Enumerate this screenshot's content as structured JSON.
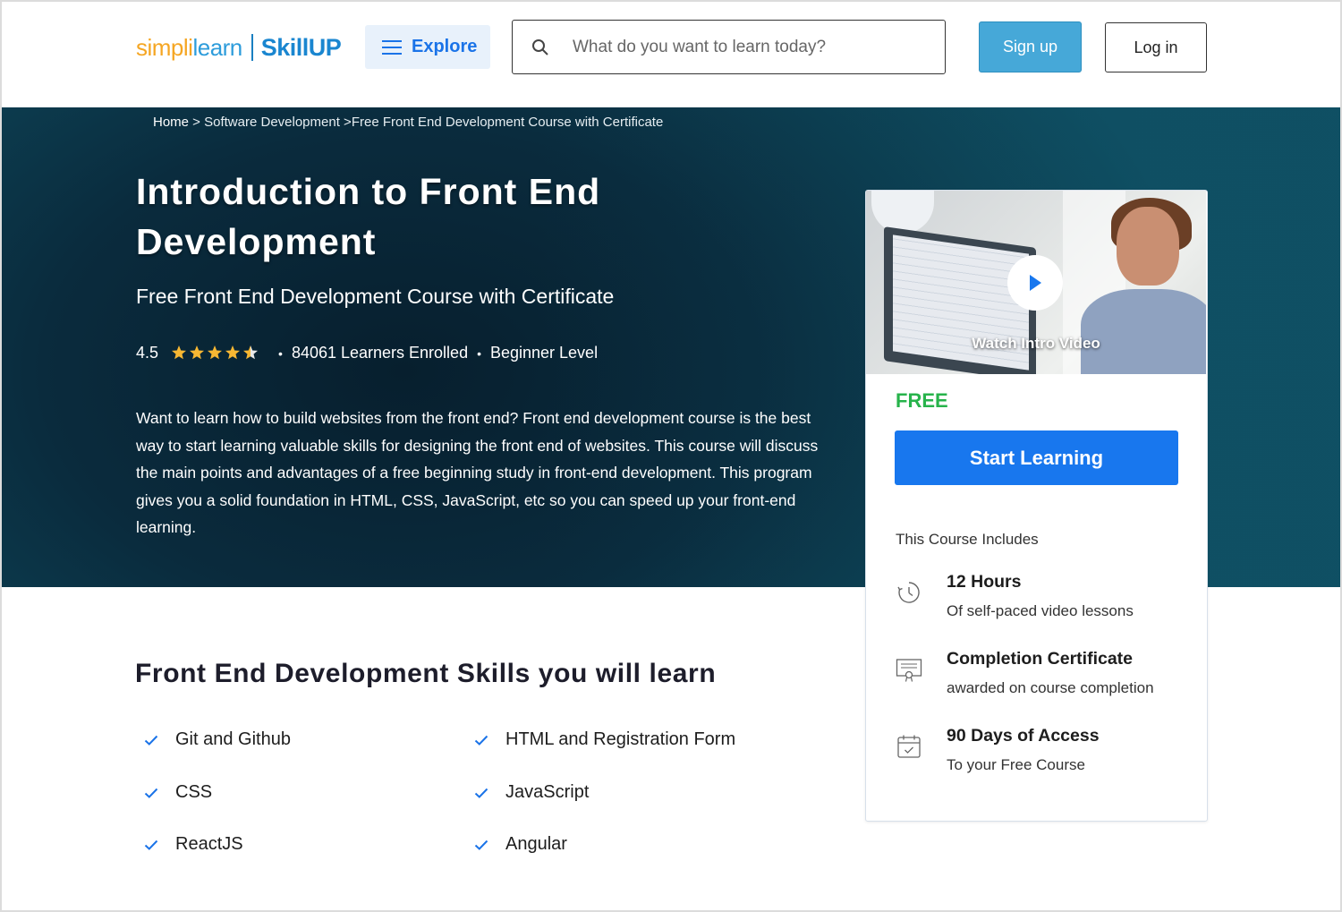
{
  "header": {
    "logo": {
      "part1": "simpli",
      "part2": "learn",
      "part3": "SkillUP"
    },
    "explore_label": "Explore",
    "search_placeholder": "What do you want to learn today?",
    "signup_label": "Sign up",
    "login_label": "Log in"
  },
  "breadcrumb": {
    "home": "Home",
    "sep1": " > ",
    "category": "Software Development",
    "sep2": " >",
    "current": "Free Front End Development Course with Certificate"
  },
  "hero": {
    "title": "Introduction to Front End Development",
    "subtitle": "Free Front End Development Course with Certificate",
    "rating": "4.5",
    "rating_stars": 4.5,
    "learners": "84061 Learners Enrolled",
    "level": "Beginner Level",
    "description": "Want to learn how to build websites from the front end? Front end development course is the best way to start learning valuable skills for designing the front end of websites. This course will discuss the main points and advantages of a free beginning study in front-end development. This program gives you a solid foundation in HTML, CSS, JavaScript, etc so you can speed up your front-end learning."
  },
  "card": {
    "video_label": "Watch Intro Video",
    "price": "FREE",
    "cta": "Start Learning",
    "includes_title": "This Course Includes",
    "items": [
      {
        "title": "12 Hours",
        "subtitle": "Of self-paced video lessons",
        "icon": "clock-icon"
      },
      {
        "title": "Completion Certificate",
        "subtitle": "awarded on course completion",
        "icon": "certificate-icon"
      },
      {
        "title": "90 Days of Access",
        "subtitle": "To your Free Course",
        "icon": "calendar-icon"
      }
    ]
  },
  "skills": {
    "title": "Front End Development Skills you will learn",
    "items": [
      "Git and Github",
      "HTML and Registration Form",
      "CSS",
      "JavaScript",
      "ReactJS",
      "Angular"
    ]
  },
  "colors": {
    "accent": "#1877ee",
    "free_green": "#27b34b",
    "star": "#f7b733",
    "hero_bg": "#0a2b3d",
    "signup_bg": "#46a8d8"
  }
}
